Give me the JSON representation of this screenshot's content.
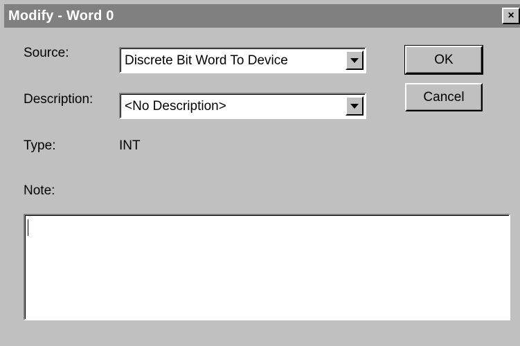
{
  "window": {
    "title": "Modify - Word 0",
    "close_glyph": "×"
  },
  "form": {
    "source_label": "Source:",
    "source_value": "Discrete Bit Word To Device",
    "description_label": "Description:",
    "description_value": "<No Description>",
    "type_label": "Type:",
    "type_value": "INT",
    "note_label": "Note:",
    "note_value": ""
  },
  "buttons": {
    "ok_label": "OK",
    "cancel_label": "Cancel"
  },
  "icons": {
    "close": "close-icon",
    "dropdown": "chevron-down-icon"
  },
  "colors": {
    "face": "#c0c0c0",
    "titlebar": "#808080",
    "field": "#ffffff"
  }
}
